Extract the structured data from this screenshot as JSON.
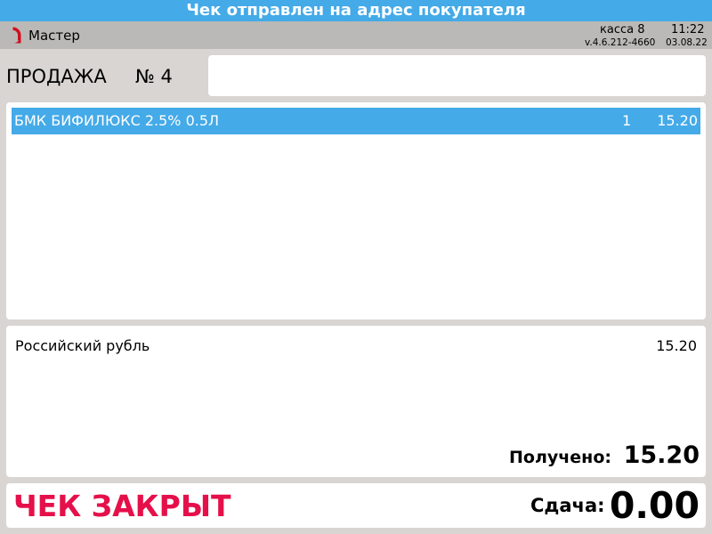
{
  "banner": {
    "text": "Чек отправлен на адрес покупателя"
  },
  "header": {
    "app_name": "Мастер",
    "kassa": "касса 8",
    "time": "11:22",
    "version": "v.4.6.212-4660",
    "date": "03.08.22"
  },
  "sale": {
    "title": "ПРОДАЖА",
    "number": "№ 4"
  },
  "input": {
    "value": ""
  },
  "items": [
    {
      "name": "БМК БИФИЛЮКС 2.5% 0.5Л",
      "qty": "1",
      "price": "15.20"
    }
  ],
  "payment": {
    "currency": "Российский рубль",
    "amount": "15.20",
    "received_label": "Получено:",
    "received_value": "15.20"
  },
  "status": {
    "text": "ЧЕК ЗАКРЫТ",
    "change_label": "Сдача:",
    "change_value": "0.00"
  },
  "colors": {
    "accent": "#44aae8",
    "closed_status": "#e5104a",
    "background": "#d8d5d2",
    "header": "#bbb9b7"
  },
  "icons": {
    "logo": "app-logo-icon"
  }
}
